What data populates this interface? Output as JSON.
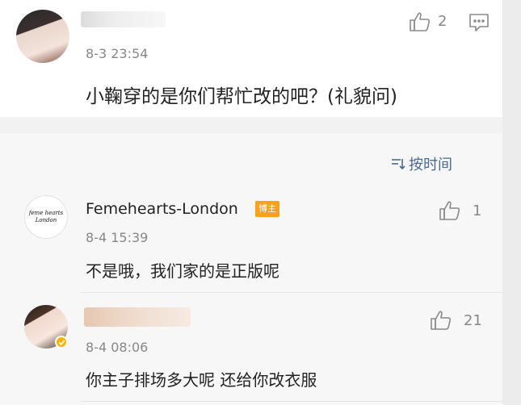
{
  "post": {
    "time": "8-3 23:54",
    "content": "小鞠穿的是你们帮忙改的吧？(礼貌问)",
    "like_count": "2",
    "avatar_icon": "user-avatar-icon",
    "comment_icon": "comment-icon"
  },
  "sort": {
    "label": "按时间",
    "icon": "sort-lines-icon",
    "color": "#4a6a92"
  },
  "comments": [
    {
      "username": "Femehearts-London",
      "badge": "博主",
      "avatar_text": "feme hearts London",
      "time": "8-4 15:39",
      "content": "不是哦，我们家的是正版呢",
      "like_count": "1"
    },
    {
      "time": "8-4 08:06",
      "content": "你主子排场多大呢 还给你改衣服",
      "like_count": "21"
    }
  ],
  "colors": {
    "badge": "#f7a11d",
    "verified": "#f6b400",
    "page_bg": "#f7f7f7"
  }
}
